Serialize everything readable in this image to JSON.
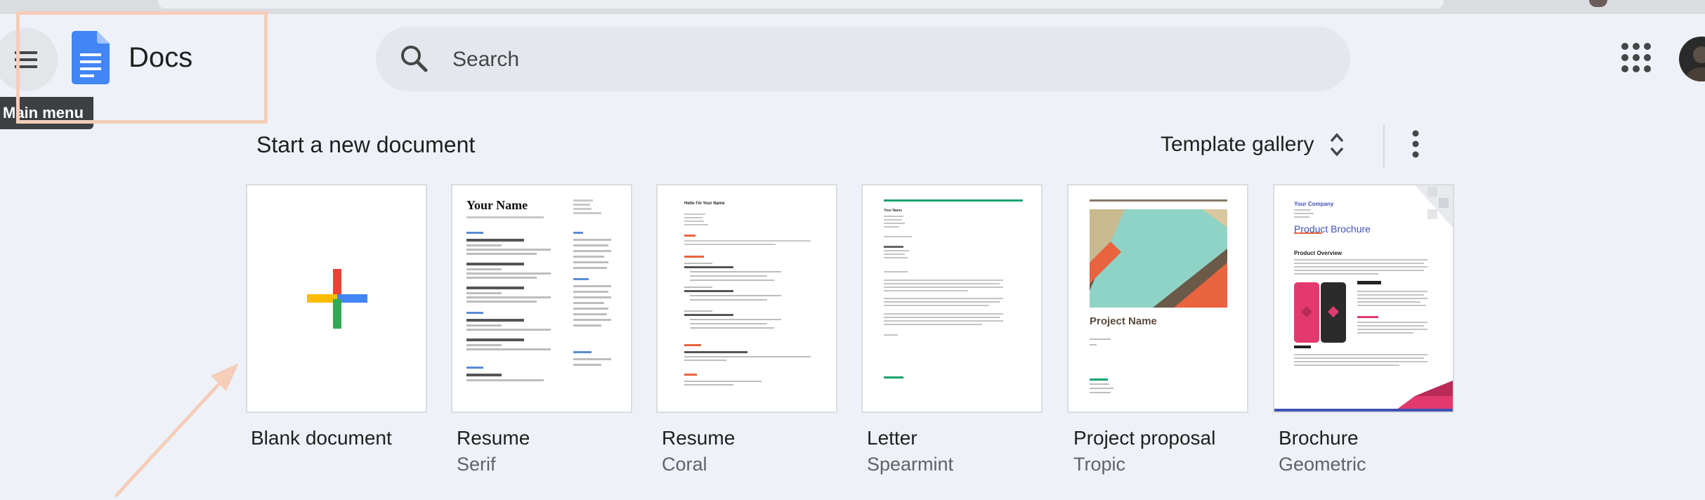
{
  "app": {
    "title": "Docs"
  },
  "header": {
    "menu_tooltip": "Main menu",
    "search": {
      "placeholder": "Search",
      "value": ""
    }
  },
  "templates_section": {
    "title": "Start a new document",
    "gallery_label": "Template gallery",
    "cards": [
      {
        "title": "Blank document",
        "subtitle": ""
      },
      {
        "title": "Resume",
        "subtitle": "Serif",
        "preview_heading": "Your Name"
      },
      {
        "title": "Resume",
        "subtitle": "Coral",
        "preview_heading": "Hello I'm Your Name"
      },
      {
        "title": "Letter",
        "subtitle": "Spearmint",
        "preview_heading": "Your Name"
      },
      {
        "title": "Project proposal",
        "subtitle": "Tropic",
        "preview_heading": "Project Name"
      },
      {
        "title": "Brochure",
        "subtitle": "Geometric",
        "preview_heading": "Product Brochure",
        "preview_company": "Your Company",
        "preview_section": "Product Overview"
      }
    ]
  },
  "colors": {
    "accent_blue": "#4285f4",
    "red": "#ea4335",
    "yellow": "#fbbc04",
    "green": "#34a853",
    "coral": "#e8633e",
    "spearmint": "#18a56e",
    "annotation": "#f5cdb9"
  }
}
